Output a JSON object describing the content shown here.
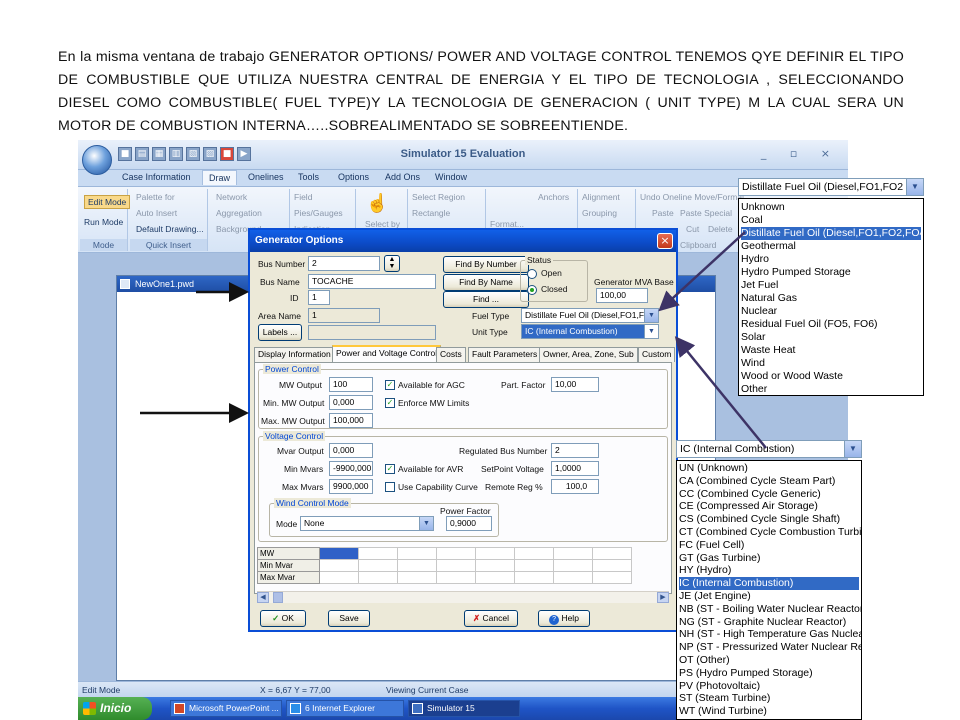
{
  "caption": "En la misma ventana de trabajo  GENERATOR OPTIONS/ POWER AND VOLTAGE CONTROL TENEMOS QYE DEFINIR EL TIPO DE COMBUSTIBLE QUE UTILIZA NUESTRA CENTRAL DE ENERGIA Y EL TIPO DE TECNOLOGIA , SELECCIONANDO DIESEL COMO COMBUSTIBLE( FUEL TYPE)Y LA TECNOLOGIA DE GENERACION ( UNIT TYPE) M LA CUAL SERA UN MOTOR DE COMBUSTION INTERNA…..SOBREALIMENTADO SE SOBREENTIENDE.",
  "app": {
    "title": "Simulator 15 Evaluation",
    "window_controls": "_ ▫ ×",
    "ribbon_tabs": [
      "Case Information",
      "Draw",
      "Onelines",
      "Tools",
      "Options",
      "Add Ons",
      "Window"
    ],
    "active_tab": "Draw",
    "ribbon": {
      "mode": {
        "edit": "Edit Mode",
        "run": "Run Mode",
        "label": "Mode"
      },
      "quick_insert": {
        "palette": "Palette for",
        "auto_insert": "Auto Insert",
        "default_drawing": "Default Drawing...",
        "label": "Quick Insert"
      },
      "network": "Network",
      "aggregation": "Aggregation",
      "background": "Background",
      "field": "Field",
      "pies_gauges": "Pies/Gauges",
      "indication": "Indication",
      "select_by": "Select by",
      "select_region": "Select Region",
      "rectangle": "Rectangle",
      "anchors": "Anchors",
      "format": "Format...",
      "alignment": "Alignment",
      "grouping": "Grouping",
      "undo_move": "Undo Oneline Move/Format",
      "paste": "Paste",
      "paste_special": "Paste Special",
      "cut": "Cut",
      "delete": "Delete",
      "clipboard": "Clipboard"
    },
    "document_title": "NewOne1.pwd",
    "status": {
      "mode": "Edit Mode",
      "coords": "X = 6,67 Y = 77,00",
      "case": "Viewing Current Case"
    },
    "taskbar": {
      "start": "Inicio",
      "tasks": [
        "Microsoft PowerPoint ...",
        "6 Internet Explorer",
        "Simulator 15"
      ]
    }
  },
  "dialog": {
    "title": "Generator Options",
    "bus_number_label": "Bus Number",
    "bus_number": "2",
    "bus_name_label": "Bus Name",
    "bus_name": "TOCACHE",
    "id_label": "ID",
    "id": "1",
    "area_name_label": "Area Name",
    "area_name": "1",
    "labels_button": "Labels ...",
    "find_by_number": "Find By Number",
    "find_by_name": "Find By Name",
    "find": "Find ...",
    "status_label": "Status",
    "open": "Open",
    "closed": "Closed",
    "mva_base_label": "Generator MVA Base",
    "mva_base": "100,00",
    "fuel_type_label": "Fuel Type",
    "fuel_type": "Distillate Fuel Oil (Diesel,FO1,FO2",
    "unit_type_label": "Unit Type",
    "unit_type": "IC (Internal Combustion)",
    "tabs": [
      "Display Information",
      "Power and Voltage Control",
      "Costs",
      "Fault Parameters",
      "Owner, Area, Zone, Sub",
      "Custom"
    ],
    "active_tab": "Power and Voltage Control",
    "power_control": {
      "legend": "Power Control",
      "mw_output_label": "MW Output",
      "mw_output": "100",
      "min_mw_label": "Min. MW Output",
      "min_mw": "0,000",
      "max_mw_label": "Max. MW Output",
      "max_mw": "100,000",
      "available_agc": "Available for AGC",
      "enforce_limits": "Enforce MW Limits",
      "part_factor_label": "Part. Factor",
      "part_factor": "10,00"
    },
    "voltage_control": {
      "legend": "Voltage Control",
      "mvar_output_label": "Mvar Output",
      "mvar_output": "0,000",
      "min_mvars_label": "Min Mvars",
      "min_mvars": "-9900,000",
      "max_mvars_label": "Max Mvars",
      "max_mvars": "9900,000",
      "available_avr": "Available for AVR",
      "use_capability": "Use Capability Curve",
      "reg_bus_label": "Regulated Bus Number",
      "reg_bus": "2",
      "setpoint_label": "SetPoint Voltage",
      "setpoint": "1,0000",
      "remote_reg_label": "Remote Reg %",
      "remote_reg": "100,0"
    },
    "wind_control": {
      "legend": "Wind Control Mode",
      "mode_label": "Mode",
      "mode": "None",
      "power_factor_label": "Power Factor",
      "power_factor": "0,9000"
    },
    "grid_rows": [
      "MW",
      "Min Mvar",
      "Max Mvar"
    ],
    "ok": "OK",
    "save": "Save",
    "cancel": "Cancel",
    "help": "Help"
  },
  "fuel_dropdown": {
    "selected": "Distillate Fuel Oil (Diesel,FO1,FO2",
    "options": [
      "Unknown",
      "Coal",
      "Distillate Fuel Oil (Diesel,FO1,FO2,FO4",
      "Geothermal",
      "Hydro",
      "Hydro Pumped Storage",
      "Jet Fuel",
      "Natural Gas",
      "Nuclear",
      "Residual Fuel Oil (FO5, FO6)",
      "Solar",
      "Waste Heat",
      "Wind",
      "Wood or Wood Waste",
      "Other"
    ],
    "highlighted_index": 2
  },
  "unit_dropdown": {
    "selected": "IC (Internal Combustion)",
    "options": [
      "UN (Unknown)",
      "CA (Combined Cycle Steam Part)",
      "CC (Combined Cycle Generic)",
      "CE (Compressed Air Storage)",
      "CS (Combined Cycle Single Shaft)",
      "CT (Combined Cycle Combustion Turbi",
      "FC (Fuel Cell)",
      "GT (Gas Turbine)",
      "HY (Hydro)",
      "IC (Internal Combustion)",
      "JE (Jet Engine)",
      "NB (ST - Boiling Water Nuclear Reactor",
      "NG (ST - Graphite Nuclear Reactor)",
      "NH (ST - High Temperature Gas Nuclea",
      "NP (ST - Pressurized Water Nuclear Re",
      "OT (Other)",
      "PS (Hydro Pumped Storage)",
      "PV (Photovoltaic)",
      "ST (Steam Turbine)",
      "WT (Wind Turbine)"
    ],
    "highlighted_index": 9
  },
  "colors": {
    "accent": "#316ac5",
    "dialog_title": "#0a4ed6",
    "arrow": "#3d3366"
  }
}
